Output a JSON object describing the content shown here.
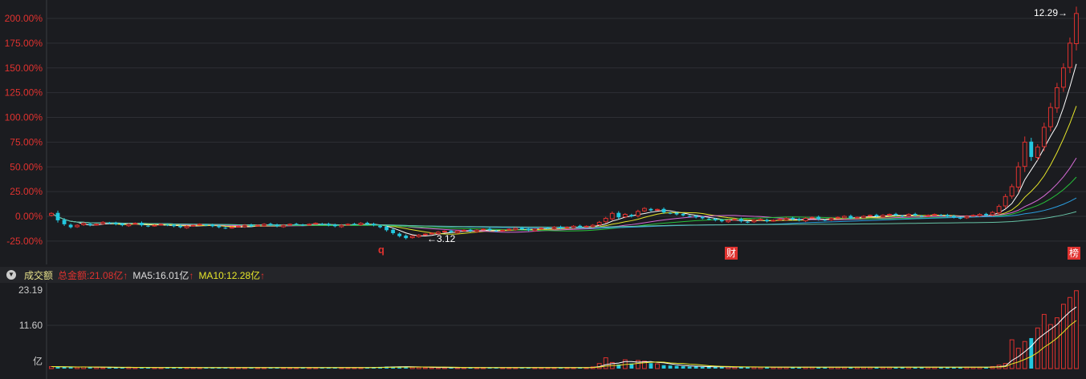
{
  "chart_data": {
    "type": "candlestick",
    "yaxis_ticks": [
      "200.00%",
      "175.00%",
      "150.00%",
      "125.00%",
      "100.00%",
      "75.00%",
      "50.00%",
      "25.00%",
      "0.00%",
      "-25.00%"
    ],
    "ylim": [
      -30,
      210
    ],
    "closes_pct": [
      3,
      -4,
      -8,
      -11,
      -9,
      -7,
      -9,
      -8,
      -6,
      -7,
      -8,
      -9,
      -8,
      -7,
      -9,
      -10,
      -9,
      -8,
      -9,
      -10,
      -11,
      -10,
      -9,
      -8,
      -9,
      -10,
      -11,
      -12,
      -11,
      -10,
      -9,
      -10,
      -9,
      -8,
      -9,
      -10,
      -9,
      -8,
      -8,
      -9,
      -8,
      -7,
      -8,
      -9,
      -10,
      -9,
      -8,
      -8,
      -7,
      -8,
      -9,
      -11,
      -14,
      -17,
      -20,
      -22,
      -20,
      -19,
      -18,
      -17,
      -16,
      -15,
      -16,
      -15,
      -14,
      -15,
      -14,
      -13,
      -14,
      -15,
      -14,
      -13,
      -12,
      -13,
      -14,
      -13,
      -12,
      -12,
      -11,
      -12,
      -11,
      -10,
      -11,
      -10,
      -9,
      -6,
      -2,
      3,
      -1,
      2,
      0,
      5,
      8,
      6,
      7,
      4,
      3,
      2,
      1,
      0,
      -1,
      -2,
      -3,
      -4,
      -5,
      -4,
      -3,
      -5,
      -6,
      -4,
      -3,
      -5,
      -4,
      -3,
      -2,
      -3,
      -4,
      -2,
      -1,
      -3,
      -4,
      -2,
      -1,
      0,
      -2,
      -1,
      0,
      1,
      0,
      1,
      2,
      1,
      0,
      2,
      1,
      0,
      1,
      2,
      1,
      0,
      -1,
      -2,
      0,
      1,
      2,
      1,
      4,
      10,
      20,
      30,
      50,
      75,
      60,
      70,
      90,
      110,
      130,
      150,
      175,
      205
    ],
    "volume_yi": [
      0.6,
      0.5,
      0.5,
      0.4,
      0.4,
      0.5,
      0.4,
      0.4,
      0.3,
      0.3,
      0.3,
      0.3,
      0.4,
      0.3,
      0.3,
      0.3,
      0.3,
      0.3,
      0.4,
      0.3,
      0.3,
      0.3,
      0.3,
      0.3,
      0.3,
      0.3,
      0.3,
      0.3,
      0.3,
      0.3,
      0.3,
      0.3,
      0.3,
      0.3,
      0.3,
      0.3,
      0.3,
      0.3,
      0.3,
      0.3,
      0.3,
      0.3,
      0.3,
      0.3,
      0.3,
      0.3,
      0.3,
      0.3,
      0.3,
      0.3,
      0.4,
      0.5,
      0.6,
      0.6,
      0.6,
      0.5,
      0.4,
      0.4,
      0.3,
      0.3,
      0.3,
      0.3,
      0.3,
      0.3,
      0.3,
      0.3,
      0.3,
      0.3,
      0.3,
      0.3,
      0.3,
      0.3,
      0.3,
      0.3,
      0.3,
      0.3,
      0.3,
      0.3,
      0.3,
      0.3,
      0.3,
      0.3,
      0.3,
      0.3,
      0.5,
      1.5,
      3.2,
      1.8,
      1.2,
      2.6,
      1.5,
      2.4,
      2.2,
      1.6,
      1.4,
      1,
      0.9,
      0.8,
      0.7,
      0.6,
      0.6,
      0.5,
      0.5,
      0.5,
      0.5,
      0.5,
      0.4,
      0.5,
      0.5,
      0.4,
      0.4,
      0.4,
      0.4,
      0.4,
      0.4,
      0.4,
      0.4,
      0.4,
      0.4,
      0.4,
      0.4,
      0.4,
      0.4,
      0.4,
      0.4,
      0.4,
      0.4,
      0.4,
      0.4,
      0.4,
      0.4,
      0.4,
      0.4,
      0.4,
      0.4,
      0.4,
      0.4,
      0.4,
      0.4,
      0.4,
      0.4,
      0.4,
      0.4,
      0.4,
      0.4,
      0.4,
      0.6,
      1,
      1.5,
      8.5,
      6,
      8,
      9,
      12,
      16,
      13,
      15,
      19,
      21,
      23
    ],
    "vol_ticks": [
      "23.19",
      "11.60",
      "亿"
    ],
    "vol_max": 23.19,
    "high_label": "12.29→",
    "low_label": "←3.12",
    "colors": {
      "up": "#e0322f",
      "down": "#22c8e0",
      "ma": [
        "#ffffff",
        "#e6e62a",
        "#d66bd6",
        "#27c43a",
        "#2a9ee0",
        "#66c2a5"
      ]
    }
  },
  "markers": {
    "q": "q",
    "cai": "财",
    "bang": "榜"
  },
  "volume_bar": {
    "title": "成交额",
    "total": "总金额:21.08亿",
    "ma5": "MA5:16.01亿",
    "ma10": "MA10:12.28亿",
    "arrow": "↑"
  }
}
